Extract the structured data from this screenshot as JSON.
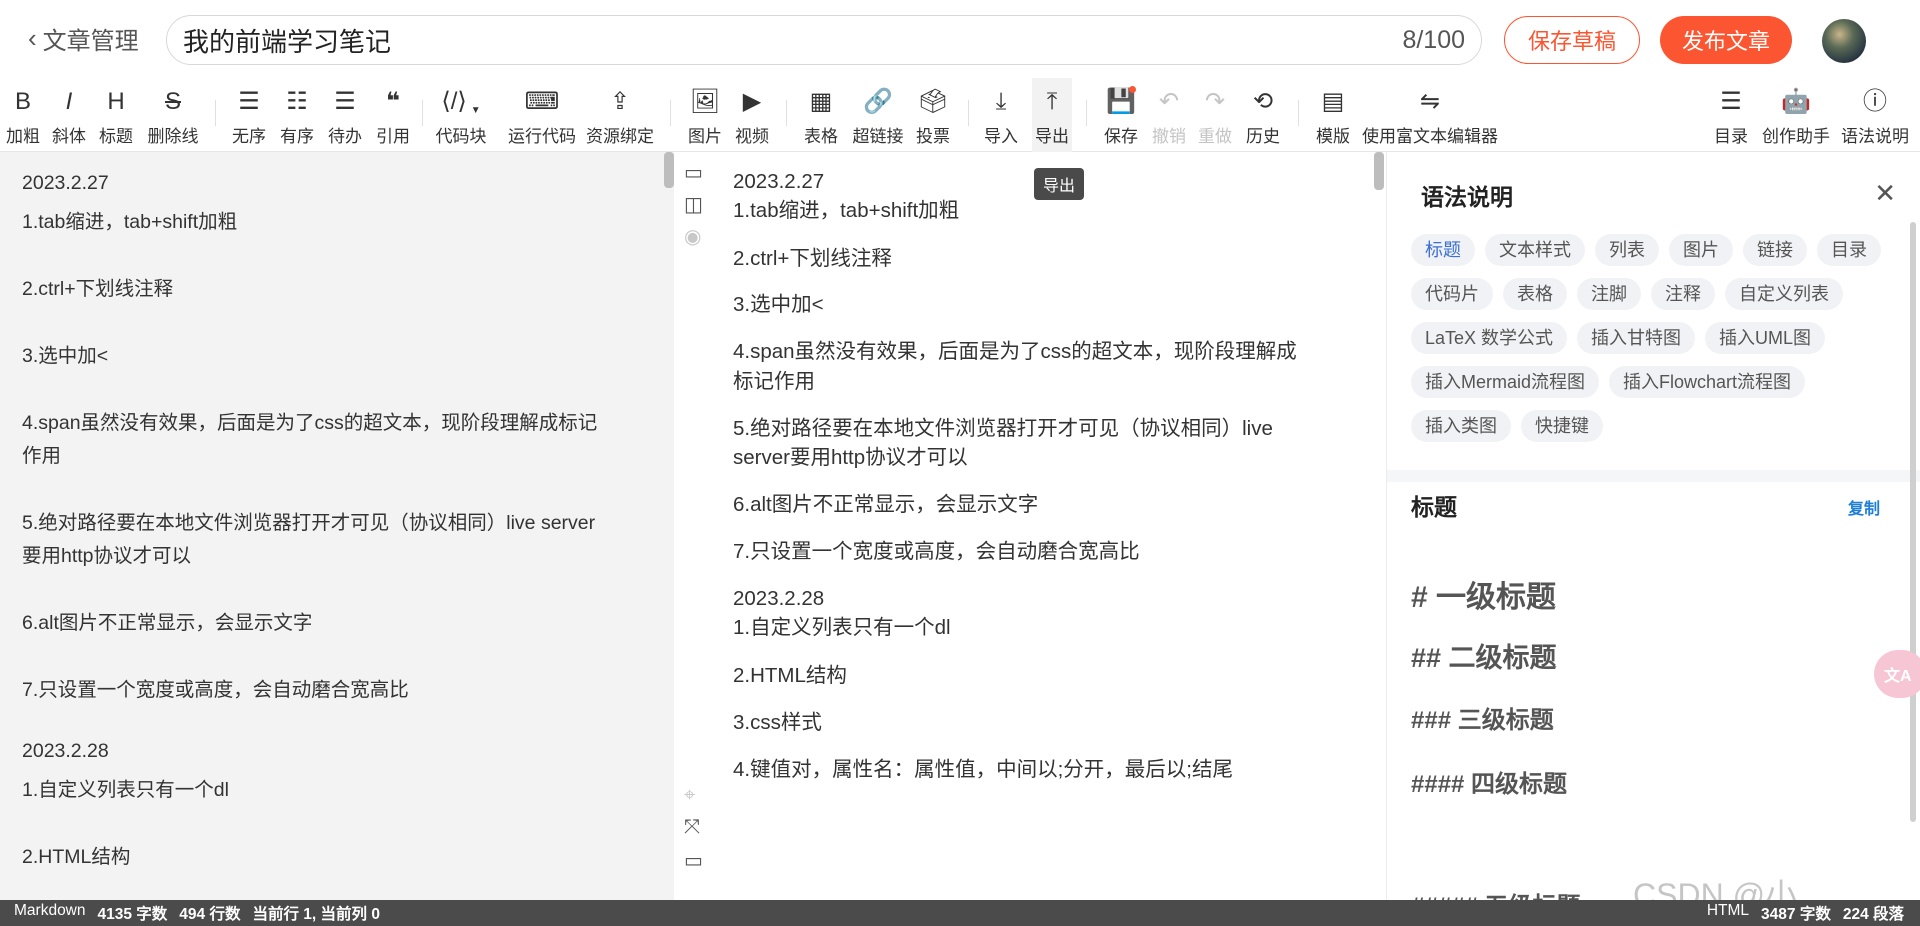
{
  "header": {
    "back_label": "文章管理",
    "title": "我的前端学习笔记",
    "counter": "8/100",
    "save_draft": "保存草稿",
    "publish": "发布文章"
  },
  "toolbar": {
    "bold": "加粗",
    "italic": "斜体",
    "heading": "标题",
    "strike": "删除线",
    "ul": "无序",
    "ol": "有序",
    "todo": "待办",
    "quote": "引用",
    "codeblock": "代码块",
    "run_code": "运行代码",
    "resource": "资源绑定",
    "image": "图片",
    "video": "视频",
    "table": "表格",
    "link": "超链接",
    "vote": "投票",
    "import": "导入",
    "export": "导出",
    "save": "保存",
    "undo": "撤销",
    "redo": "重做",
    "history": "历史",
    "template": "模版",
    "rich_editor": "使用富文本编辑器",
    "toc": "目录",
    "assistant": "创作助手",
    "syntax": "语法说明",
    "tooltip": "导出"
  },
  "markdown_lines": [
    "2023.2.27",
    "1.tab缩进，tab+shift加粗",
    "2.ctrl+下划线注释",
    "3.选中加<",
    "4.span虽然没有效果，后面是为了css的超文本，现阶段理解成标记",
    "作用",
    "5.绝对路径要在本地文件浏览器打开才可见（协议相同）live server",
    "要用http协议才可以",
    "6.alt图片不正常显示，会显示文字",
    "7.只设置一个宽度或高度，会自动磨合宽高比",
    "2023.2.28",
    "1.自定义列表只有一个dl",
    "2.HTML结构"
  ],
  "preview_lines": [
    "2023.2.27",
    "1.tab缩进，tab+shift加粗",
    "2.ctrl+下划线注释",
    "3.选中加<",
    "4.span虽然没有效果，后面是为了css的超文本，现阶段理解成",
    "标记作用",
    "5.绝对路径要在本地文件浏览器打开才可见（协议相同）live",
    "server要用http协议才可以",
    "6.alt图片不正常显示，会显示文字",
    "7.只设置一个宽度或高度，会自动磨合宽高比",
    "2023.2.28",
    "1.自定义列表只有一个dl",
    "2.HTML结构",
    "3.css样式",
    "4.键值对，属性名：属性值，中间以;分开，最后以;结尾"
  ],
  "panel": {
    "title": "语法说明",
    "tags": [
      "标题",
      "文本样式",
      "列表",
      "图片",
      "链接",
      "目录",
      "代码片",
      "表格",
      "注脚",
      "注释",
      "自定义列表",
      "LaTeX 数学公式",
      "插入甘特图",
      "插入UML图",
      "插入Mermaid流程图",
      "插入Flowchart流程图",
      "插入类图",
      "快捷键"
    ],
    "section_title": "标题",
    "copy": "复制",
    "h1": "# 一级标题",
    "h2": "## 二级标题",
    "h3": "### 三级标题",
    "h4": "#### 四级标题",
    "h5": "##### 五级标题"
  },
  "watermark": "CSDN @小",
  "status": {
    "mode_left": "Markdown",
    "chars_left": "4135 字数",
    "lines_left": "494 行数",
    "cursor": "当前行 1, 当前列 0",
    "mode_right": "HTML",
    "chars_right": "3487 字数",
    "paras_right": "224 段落"
  },
  "colors": {
    "accent": "#fc5531",
    "link_blue": "#1e7fd6",
    "tag_active": "#3b6fd3",
    "status_bg": "#4b4b4b"
  }
}
